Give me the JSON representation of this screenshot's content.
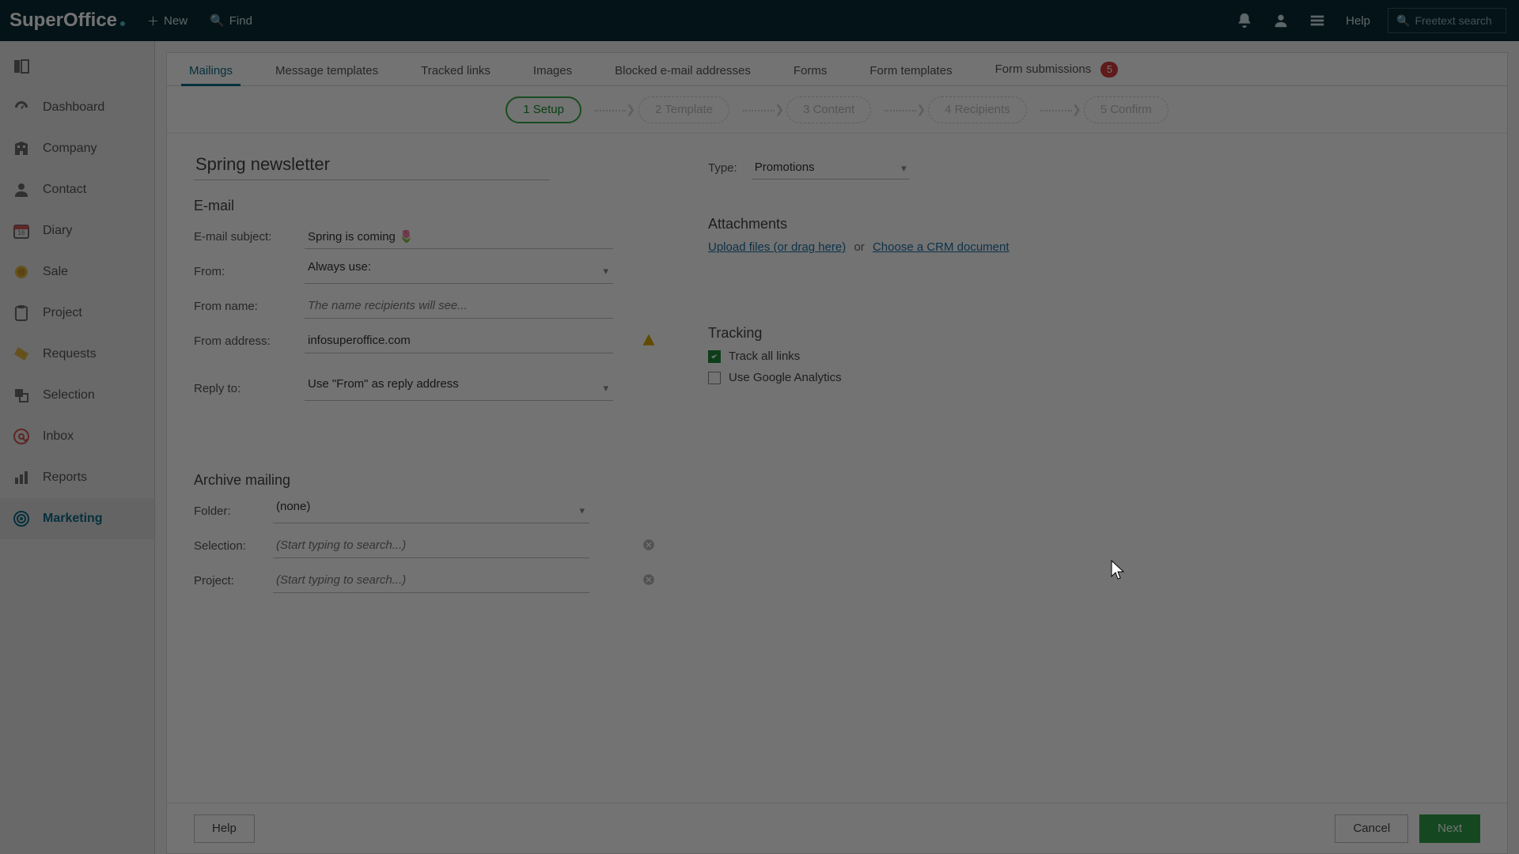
{
  "topbar": {
    "brand": "SuperOffice",
    "new": "New",
    "find": "Find",
    "help": "Help",
    "search_placeholder": "Freetext search"
  },
  "nav": {
    "items": [
      {
        "label": ""
      },
      {
        "label": "Dashboard"
      },
      {
        "label": "Company"
      },
      {
        "label": "Contact"
      },
      {
        "label": "Diary"
      },
      {
        "label": "Sale"
      },
      {
        "label": "Project"
      },
      {
        "label": "Requests"
      },
      {
        "label": "Selection"
      },
      {
        "label": "Inbox"
      },
      {
        "label": "Reports"
      },
      {
        "label": "Marketing"
      }
    ]
  },
  "tabs": [
    {
      "label": "Mailings"
    },
    {
      "label": "Message templates"
    },
    {
      "label": "Tracked links"
    },
    {
      "label": "Images"
    },
    {
      "label": "Blocked e-mail addresses"
    },
    {
      "label": "Forms"
    },
    {
      "label": "Form templates"
    },
    {
      "label": "Form submissions",
      "badge": "5"
    }
  ],
  "wizard": [
    {
      "label": "1 Setup"
    },
    {
      "label": "2 Template"
    },
    {
      "label": "3 Content"
    },
    {
      "label": "4 Recipients"
    },
    {
      "label": "5 Confirm"
    }
  ],
  "form": {
    "name_value": "Spring newsletter",
    "type_label": "Type:",
    "type_value": "Promotions",
    "email_heading": "E-mail",
    "subject_label": "E-mail subject:",
    "subject_value": "Spring is coming 🌷",
    "from_label": "From:",
    "from_value": "Always use:",
    "from_name_label": "From name:",
    "from_name_placeholder": "The name recipients will see...",
    "from_addr_label": "From address:",
    "from_addr_value": "infosuperoffice.com",
    "reply_label": "Reply to:",
    "reply_value": "Use \"From\" as reply address",
    "attachments_heading": "Attachments",
    "upload_link": "Upload files (or drag here)",
    "or": "or",
    "choose_crm_link": "Choose a CRM document",
    "archive_heading": "Archive mailing",
    "folder_label": "Folder:",
    "folder_value": "(none)",
    "selection_label": "Selection:",
    "selection_placeholder": "(Start typing to search...)",
    "project_label": "Project:",
    "project_placeholder": "(Start typing to search...)",
    "tracking_heading": "Tracking",
    "track_links_label": "Track all links",
    "use_ga_label": "Use Google Analytics"
  },
  "footer": {
    "help": "Help",
    "cancel": "Cancel",
    "next": "Next"
  }
}
